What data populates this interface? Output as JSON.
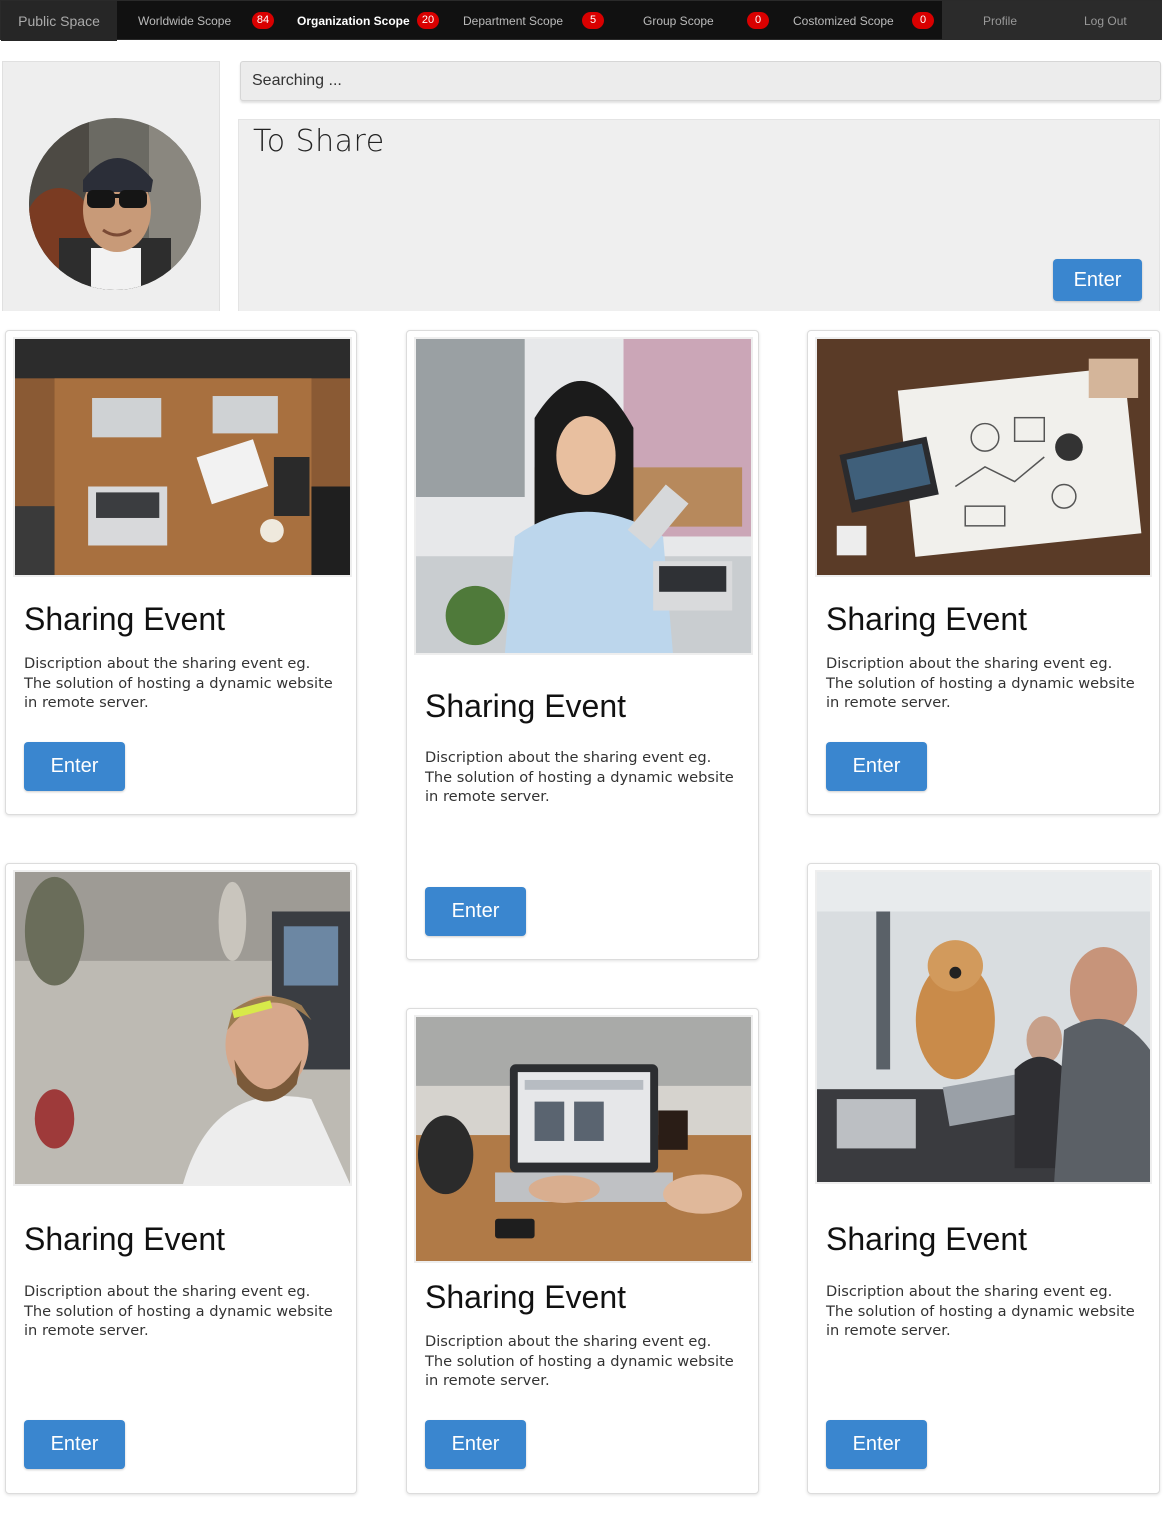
{
  "nav": {
    "brand": "Public Space",
    "scopes": [
      {
        "label": "Worldwide Scope",
        "count": "84"
      },
      {
        "label": "Organization Scope",
        "count": "20"
      },
      {
        "label": "Department Scope",
        "count": "5"
      },
      {
        "label": "Group Scope",
        "count": "0"
      },
      {
        "label": "Costomized Scope",
        "count": "0"
      }
    ],
    "active_scope": "Organization Scope",
    "profile": "Profile",
    "logout": "Log Out",
    "badge_color": "#d90000"
  },
  "search": {
    "placeholder": "Searching ..."
  },
  "share": {
    "title": "To Share",
    "enter_label": "Enter"
  },
  "accent_color": "#3a86cf",
  "cards": [
    {
      "title": "Sharing Event",
      "description": "Discription about the sharing event eg. The solution of hosting a dynamic website in remote server.",
      "button": "Enter"
    },
    {
      "title": "Sharing Event",
      "description": "Discription about the sharing event eg. The solution of hosting a dynamic website in remote server.",
      "button": "Enter"
    },
    {
      "title": "Sharing Event",
      "description": "Discription about the sharing event eg. The solution of hosting a dynamic website in remote server.",
      "button": "Enter"
    },
    {
      "title": "Sharing Event",
      "description": "Discription about the sharing event eg. The solution of hosting a dynamic website in remote server.",
      "button": "Enter"
    },
    {
      "title": "Sharing Event",
      "description": "Discription about the sharing event eg. The solution of hosting a dynamic website in remote server.",
      "button": "Enter"
    },
    {
      "title": "Sharing Event",
      "description": "Discription about the sharing event eg. The solution of hosting a dynamic website in remote server.",
      "button": "Enter"
    }
  ]
}
